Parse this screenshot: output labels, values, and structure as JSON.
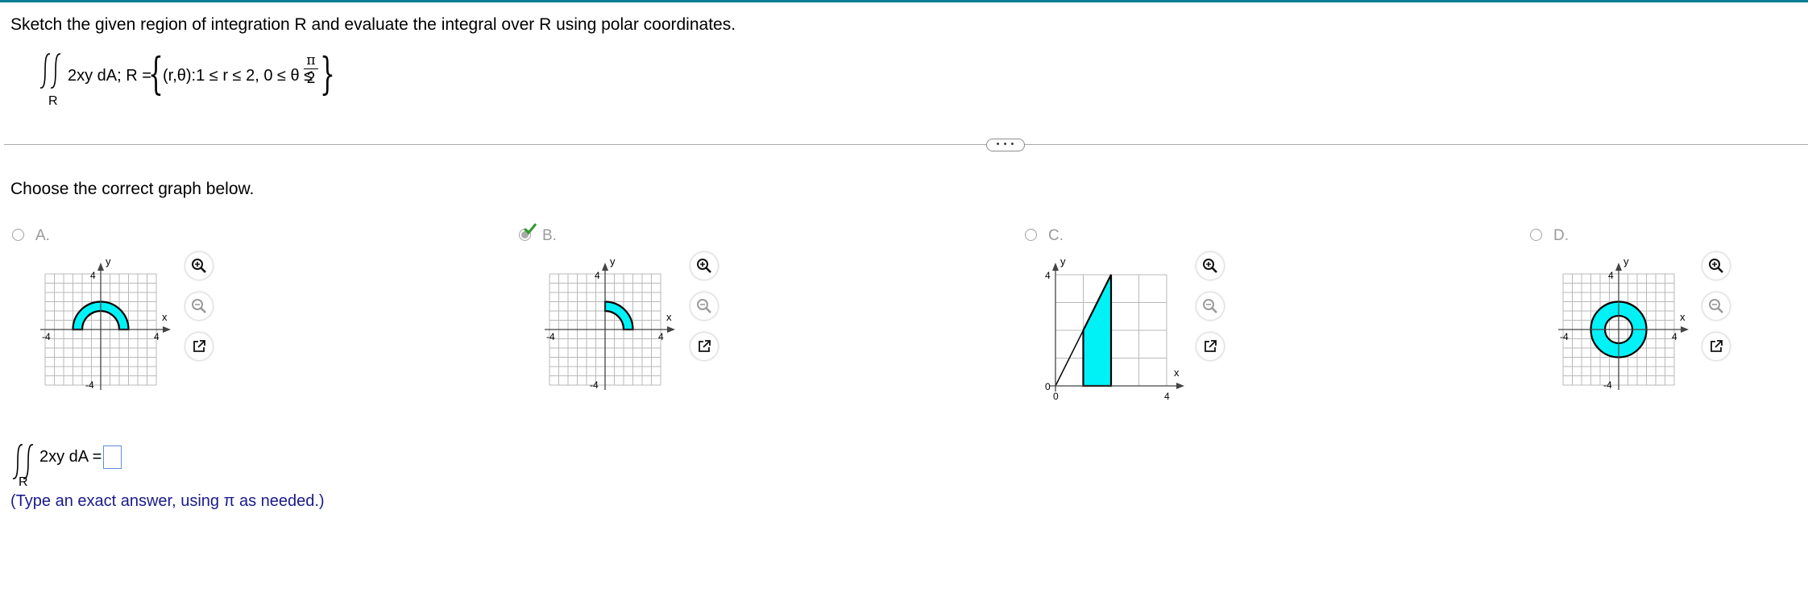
{
  "question": {
    "instruction": "Sketch the given region of integration R and evaluate the integral over R using polar coordinates.",
    "integrand": "2xy dA; R =",
    "region": "(r,θ):1 ≤ r ≤ 2, 0 ≤ θ ≤",
    "pi": "π",
    "two": "2",
    "sub_r": "R"
  },
  "more_button": "• • •",
  "prompt": "Choose the correct graph below.",
  "options": [
    {
      "letter": "A.",
      "selected": false,
      "correct_mark": false,
      "axis_x": "x",
      "axis_y": "y",
      "tick_pos": "4",
      "tick_neg": "-4",
      "tick_x_pos": "4",
      "tick_x_neg": "-4",
      "region": "upper half annulus"
    },
    {
      "letter": "B.",
      "selected": true,
      "correct_mark": true,
      "axis_x": "x",
      "axis_y": "y",
      "tick_pos": "4",
      "tick_neg": "-4",
      "tick_x_pos": "4",
      "tick_x_neg": "-4",
      "region": "quarter annulus"
    },
    {
      "letter": "C.",
      "selected": false,
      "correct_mark": false,
      "axis_x": "x",
      "axis_y": "y",
      "tick_y_top": "4",
      "tick_y_zero": "0",
      "tick_x_zero": "0",
      "tick_x_right": "4",
      "region": "vertical strip"
    },
    {
      "letter": "D.",
      "selected": false,
      "correct_mark": false,
      "axis_x": "x",
      "axis_y": "y",
      "tick_pos": "4",
      "tick_neg": "-4",
      "tick_x_pos": "4",
      "tick_x_neg": "-4",
      "region": "full annulus"
    }
  ],
  "answer": {
    "integrand": "2xy dA =",
    "sub_r": "R",
    "value": "",
    "hint": "(Type an exact answer, using π as needed.)"
  },
  "colors": {
    "fill": "#00f2f7",
    "grid": "#b9b9b9",
    "accent": "#0a7d95",
    "check": "#2e9a2e",
    "hint": "#1a1a8c"
  },
  "icons": [
    "zoom-in-icon",
    "zoom-out-icon",
    "external-link-icon",
    "checkmark-icon",
    "double-integral-icon"
  ]
}
